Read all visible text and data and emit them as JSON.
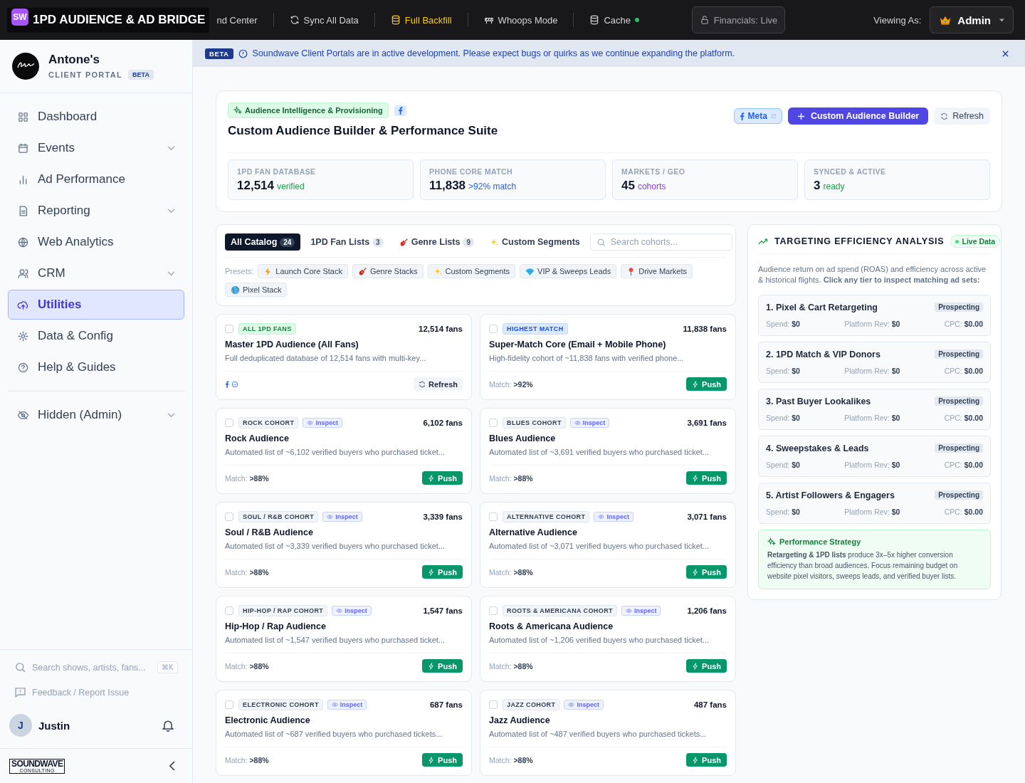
{
  "topbar": {
    "brand_mark": "SW",
    "brand": "1PD AUDIENCE & AD BRIDGE",
    "nav": [
      {
        "label": "nd Center",
        "kind": "plain",
        "highlighted": false,
        "live": false
      },
      {
        "label": "Sync All Data",
        "kind": "sync",
        "highlighted": false,
        "live": false
      },
      {
        "label": "Full Backfill",
        "kind": "backfill",
        "highlighted": true,
        "live": false
      },
      {
        "label": "Whoops Mode",
        "kind": "mode",
        "highlighted": false,
        "live": false
      },
      {
        "label": "Cache",
        "kind": "cache",
        "highlighted": false,
        "live": true
      }
    ],
    "financials": "Financials: Live",
    "viewing_label": "Viewing As:",
    "role": "Admin"
  },
  "sidebar": {
    "client": "Antone's",
    "portal": "CLIENT PORTAL",
    "portal_badge": "BETA",
    "items": [
      {
        "label": "Dashboard",
        "selected": false,
        "has_submenu": false
      },
      {
        "label": "Events",
        "selected": false,
        "has_submenu": true
      },
      {
        "label": "Ad Performance",
        "selected": false,
        "has_submenu": false
      },
      {
        "label": "Reporting",
        "selected": false,
        "has_submenu": true
      },
      {
        "label": "Web Analytics",
        "selected": false,
        "has_submenu": false
      },
      {
        "label": "CRM",
        "selected": false,
        "has_submenu": true
      },
      {
        "label": "Utilities",
        "selected": true,
        "has_submenu": false
      },
      {
        "label": "Data & Config",
        "selected": false,
        "has_submenu": false
      },
      {
        "label": "Help & Guides",
        "selected": false,
        "has_submenu": false
      }
    ],
    "admin_item": {
      "label": "Hidden (Admin)",
      "has_submenu": true
    },
    "search": {
      "placeholder": "Search shows, artists, fans...",
      "shortcut": "⌘K"
    },
    "feedback": "Feedback / Report Issue",
    "user": {
      "initial": "J",
      "name": "Justin"
    },
    "footer_logo": [
      "SOUNDWAVE",
      "CONSULTING"
    ]
  },
  "banner": {
    "badge": "BETA",
    "message": "Soundwave Client Portals are in active development. Please expect bugs or quirks as we continue expanding the platform."
  },
  "header": {
    "badge": "Audience Intelligence & Provisioning",
    "title": "Custom Audience Builder & Performance Suite",
    "buttons": [
      {
        "label": "Meta",
        "kind": "meta"
      },
      {
        "label": "Custom Audience Builder",
        "kind": "primary"
      },
      {
        "label": "Refresh",
        "kind": "refresh"
      }
    ],
    "stats": [
      {
        "label": "1PD FAN DATABASE",
        "value": "12,514",
        "note": "verified",
        "color": "#16a34a"
      },
      {
        "label": "PHONE CORE MATCH",
        "value": "11,838",
        "note": ">92% match",
        "color": "#2563eb"
      },
      {
        "label": "MARKETS / GEO",
        "value": "45",
        "note": "cohorts",
        "color": "#9333ea"
      },
      {
        "label": "SYNCED & ACTIVE",
        "value": "3",
        "note": "ready",
        "color": "#16a34a"
      }
    ]
  },
  "tabs": [
    {
      "label": "All Catalog",
      "count": "24",
      "selected": true
    },
    {
      "label": "1PD Fan Lists",
      "count": "3",
      "selected": false
    },
    {
      "label": "Genre Lists",
      "count": "9",
      "selected": false
    },
    {
      "label": "Custom Segments",
      "selected": false
    }
  ],
  "search": {
    "placeholder": "Search cohorts..."
  },
  "presets_label": "Presets:",
  "presets": [
    {
      "label": "Launch Core Stack"
    },
    {
      "label": "Genre Stacks"
    },
    {
      "label": "Custom Segments"
    },
    {
      "label": "VIP & Sweeps Leads"
    },
    {
      "label": "Drive Markets"
    },
    {
      "label": "Pixel Stack"
    }
  ],
  "cohorts": [
    {
      "badge": "ALL 1PD FANS",
      "kind": "green",
      "fans": "12,514 fans",
      "title": "Master 1PD Audience (All Fans)",
      "description": "Full deduplicated database of 12,514 fans with multi-key...",
      "checked": false,
      "footer": {
        "kind": "synced",
        "button": "Refresh"
      }
    },
    {
      "badge": "HIGHEST MATCH",
      "kind": "blue",
      "fans": "11,838 fans",
      "title": "Super-Match Core (Email + Mobile Phone)",
      "description": "High-fidelity cohort of ~11,838 fans with verified phone...",
      "checked": false,
      "footer": {
        "kind": "match",
        "label": "Match:",
        "value": ">92%",
        "button": "Push"
      }
    },
    {
      "badge": "ROCK COHORT",
      "kind": "gray",
      "inspect": "Inspect",
      "fans": "6,102 fans",
      "title": "Rock Audience",
      "description": "Automated list of ~6,102 verified buyers who purchased ticket...",
      "checked": false,
      "footer": {
        "kind": "match",
        "label": "Match:",
        "value": ">88%",
        "button": "Push"
      }
    },
    {
      "badge": "BLUES COHORT",
      "kind": "gray",
      "inspect": "Inspect",
      "fans": "3,691 fans",
      "title": "Blues Audience",
      "description": "Automated list of ~3,691 verified buyers who purchased ticket...",
      "checked": false,
      "footer": {
        "kind": "match",
        "label": "Match:",
        "value": ">88%",
        "button": "Push"
      }
    },
    {
      "badge": "SOUL / R&B COHORT",
      "kind": "gray",
      "inspect": "Inspect",
      "fans": "3,339 fans",
      "title": "Soul / R&B Audience",
      "description": "Automated list of ~3,339 verified buyers who purchased ticket...",
      "checked": false,
      "footer": {
        "kind": "match",
        "label": "Match:",
        "value": ">88%",
        "button": "Push"
      }
    },
    {
      "badge": "ALTERNATIVE COHORT",
      "kind": "gray",
      "inspect": "Inspect",
      "fans": "3,071 fans",
      "title": "Alternative Audience",
      "description": "Automated list of ~3,071 verified buyers who purchased ticket...",
      "checked": false,
      "footer": {
        "kind": "match",
        "label": "Match:",
        "value": ">88%",
        "button": "Push"
      }
    },
    {
      "badge": "HIP-HOP / RAP COHORT",
      "kind": "gray",
      "inspect": "Inspect",
      "fans": "1,547 fans",
      "title": "Hip-Hop / Rap Audience",
      "description": "Automated list of ~1,547 verified buyers who purchased ticket...",
      "checked": false,
      "footer": {
        "kind": "match",
        "label": "Match:",
        "value": ">88%",
        "button": "Push"
      }
    },
    {
      "badge": "ROOTS & AMERICANA COHORT",
      "kind": "gray",
      "inspect": "Inspect",
      "fans": "1,206 fans",
      "title": "Roots & Americana Audience",
      "description": "Automated list of ~1,206 verified buyers who purchased ticket...",
      "checked": false,
      "footer": {
        "kind": "match",
        "label": "Match:",
        "value": ">88%",
        "button": "Push"
      }
    },
    {
      "badge": "ELECTRONIC COHORT",
      "kind": "gray",
      "inspect": "Inspect",
      "fans": "687 fans",
      "title": "Electronic Audience",
      "description": "Automated list of ~687 verified buyers who purchased tickets...",
      "checked": false,
      "footer": {
        "kind": "match",
        "label": "Match:",
        "value": ">88%",
        "button": "Push"
      }
    },
    {
      "badge": "JAZZ COHORT",
      "kind": "gray",
      "inspect": "Inspect",
      "fans": "487 fans",
      "title": "Jazz Audience",
      "description": "Automated list of ~487 verified buyers who purchased tickets...",
      "checked": false,
      "footer": {
        "kind": "match",
        "label": "Match:",
        "value": ">88%",
        "button": "Push"
      }
    }
  ],
  "analysis": {
    "title": "TARGETING EFFICIENCY ANALYSIS",
    "live_badge": "Live Data",
    "description": "Audience return on ad spend (ROAS) and efficiency across active & historical flights. **Click any tier to inspect matching ad sets:**",
    "tiers": [
      {
        "name": "1. Pixel & Cart Retargeting",
        "tag": "Prospecting",
        "metrics": [
          {
            "label": "Spend:",
            "value": "$0"
          },
          {
            "label": "Platform Rev:",
            "value": "$0"
          },
          {
            "label": "CPC:",
            "value": "$0.00"
          }
        ]
      },
      {
        "name": "2. 1PD Match & VIP Donors",
        "tag": "Prospecting",
        "metrics": [
          {
            "label": "Spend:",
            "value": "$0"
          },
          {
            "label": "Platform Rev:",
            "value": "$0"
          },
          {
            "label": "CPC:",
            "value": "$0.00"
          }
        ]
      },
      {
        "name": "3. Past Buyer Lookalikes",
        "tag": "Prospecting",
        "metrics": [
          {
            "label": "Spend:",
            "value": "$0"
          },
          {
            "label": "Platform Rev:",
            "value": "$0"
          },
          {
            "label": "CPC:",
            "value": "$0.00"
          }
        ]
      },
      {
        "name": "4. Sweepstakes & Leads",
        "tag": "Prospecting",
        "metrics": [
          {
            "label": "Spend:",
            "value": "$0"
          },
          {
            "label": "Platform Rev:",
            "value": "$0"
          },
          {
            "label": "CPC:",
            "value": "$0.00"
          }
        ]
      },
      {
        "name": "5. Artist Followers & Engagers",
        "tag": "Prospecting",
        "metrics": [
          {
            "label": "Spend:",
            "value": "$0"
          },
          {
            "label": "Platform Rev:",
            "value": "$0"
          },
          {
            "label": "CPC:",
            "value": "$0.00"
          }
        ]
      }
    ],
    "strategy": {
      "title": "Performance Strategy",
      "text": "**Retargeting & 1PD lists** produce 3x–5x higher conversion efficiency than broad audiences. Focus remaining budget on website pixel visitors, sweeps leads, and verified buyer lists."
    }
  }
}
